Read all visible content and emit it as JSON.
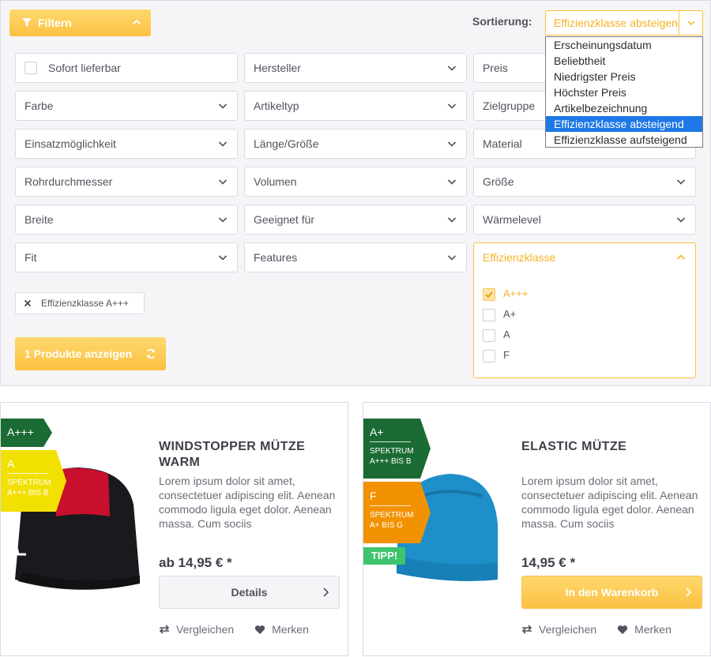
{
  "filter": {
    "toggle_label": "Filtern",
    "sort_label": "Sortierung:",
    "sort_value": "Effizienzklasse absteigend",
    "sort_options": [
      "Erscheinungsdatum",
      "Beliebtheit",
      "Niedrigster Preis",
      "Höchster Preis",
      "Artikelbezeichnung",
      "Effizienzklasse absteigend",
      "Effizienzklasse aufsteigend"
    ],
    "boxes": {
      "sofort": "Sofort lieferbar",
      "hersteller": "Hersteller",
      "preis": "Preis",
      "farbe": "Farbe",
      "artikeltyp": "Artikeltyp",
      "zielgruppe": "Zielgruppe",
      "einsatz": "Einsatzmöglichkeit",
      "laenge": "Länge/Größe",
      "material": "Material",
      "rohr": "Rohrdurchmesser",
      "volumen": "Volumen",
      "groesse": "Größe",
      "breite": "Breite",
      "geeignet": "Geeignet für",
      "waermelevel": "Wärmelevel",
      "fit": "Fit",
      "features": "Features"
    },
    "efficiency": {
      "title": "Effizienzklasse",
      "options": [
        "A+++",
        "A+",
        "A",
        "F"
      ],
      "checked": "A+++"
    },
    "active_filter": "Effizienzklasse A+++",
    "show_button": "1 Produkte anzeigen",
    "accent_color": "#fbc141"
  },
  "products": [
    {
      "title": "WINDSTOPPER MÜTZE WARM",
      "description": "Lorem ipsum dolor sit amet, consectetuer adipiscing elit. Aenean commodo ligula eget dolor. Aenean massa. Cum sociis",
      "price": "ab 14,95 € *",
      "button": "Details",
      "compare": "Vergleichen",
      "remember": "Merken",
      "badge_class": "A+++",
      "badge_class_color": "#1b6b34",
      "badge_spectrum_class": "A",
      "badge_spectrum_color": "#f2e000",
      "badge_spectrum_line1": "SPEKTRUM",
      "badge_spectrum_line2": "A+++ BIS B"
    },
    {
      "title": "ELASTIC MÜTZE",
      "description": "Lorem ipsum dolor sit amet, consectetuer adipiscing elit. Aenean commodo ligula eget dolor. Aenean massa. Cum sociis",
      "price": "14,95 € *",
      "button": "In den Warenkorb",
      "compare": "Vergleichen",
      "remember": "Merken",
      "badge_class": "A+",
      "badge_class_color": "#1b6b34",
      "badge_class_line1": "SPEKTRUM",
      "badge_class_line2": "A+++ BIS B",
      "badge_spectrum_class": "F",
      "badge_spectrum_color": "#f39200",
      "badge_spectrum_line1": "SPEKTRUM",
      "badge_spectrum_line2": "A+ BIS G",
      "tag": "TIPP!"
    }
  ]
}
